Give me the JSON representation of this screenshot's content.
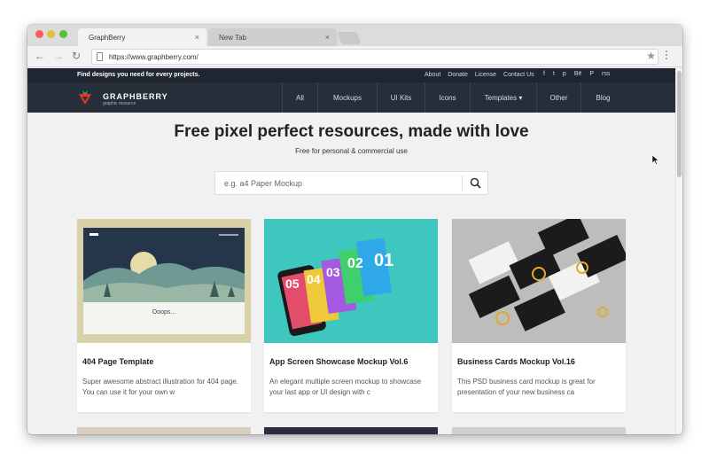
{
  "browser": {
    "active_tab": "GraphBerry",
    "inactive_tab": "New Tab",
    "tab_close": "×",
    "url": "https://www.graphberry.com/"
  },
  "site": {
    "tagline": "Find designs you need for every projects.",
    "top_links": [
      "About",
      "Donate",
      "License",
      "Contact Us"
    ],
    "socials": [
      "f",
      "t",
      "p",
      "Bē",
      "P",
      "rss"
    ],
    "logo_name": "GRAPHBERRY",
    "logo_sub": "graphic resource",
    "nav": [
      {
        "label": "All"
      },
      {
        "label": "Mockups"
      },
      {
        "label": "UI Kits"
      },
      {
        "label": "Icons"
      },
      {
        "label": "Templates ▾"
      },
      {
        "label": "Other"
      },
      {
        "label": "Blog"
      }
    ]
  },
  "hero": {
    "title": "Free pixel perfect resources, made with love",
    "subtitle": "Free for personal & commercial use"
  },
  "search": {
    "placeholder": "e.g. a4 Paper Mockup"
  },
  "cards": [
    {
      "title": "404 Page Template",
      "desc": "Super awesome abstract illustration for 404 page. You can use it for your own w",
      "thumb_text": "Ooops..."
    },
    {
      "title": "App Screen Showcase Mockup Vol.6",
      "desc": "An elegant multiple screen mockup to showcase your last app or UI design with c",
      "thumb_numbers": [
        "05",
        "04",
        "03",
        "02",
        "01"
      ]
    },
    {
      "title": "Business Cards Mockup Vol.16",
      "desc": "This PSD business card mockup is great for presentation of your new business ca"
    }
  ],
  "colors": {
    "navbar": "#262e3a",
    "topstrip": "#1f2631",
    "brand_red": "#e5322d"
  }
}
